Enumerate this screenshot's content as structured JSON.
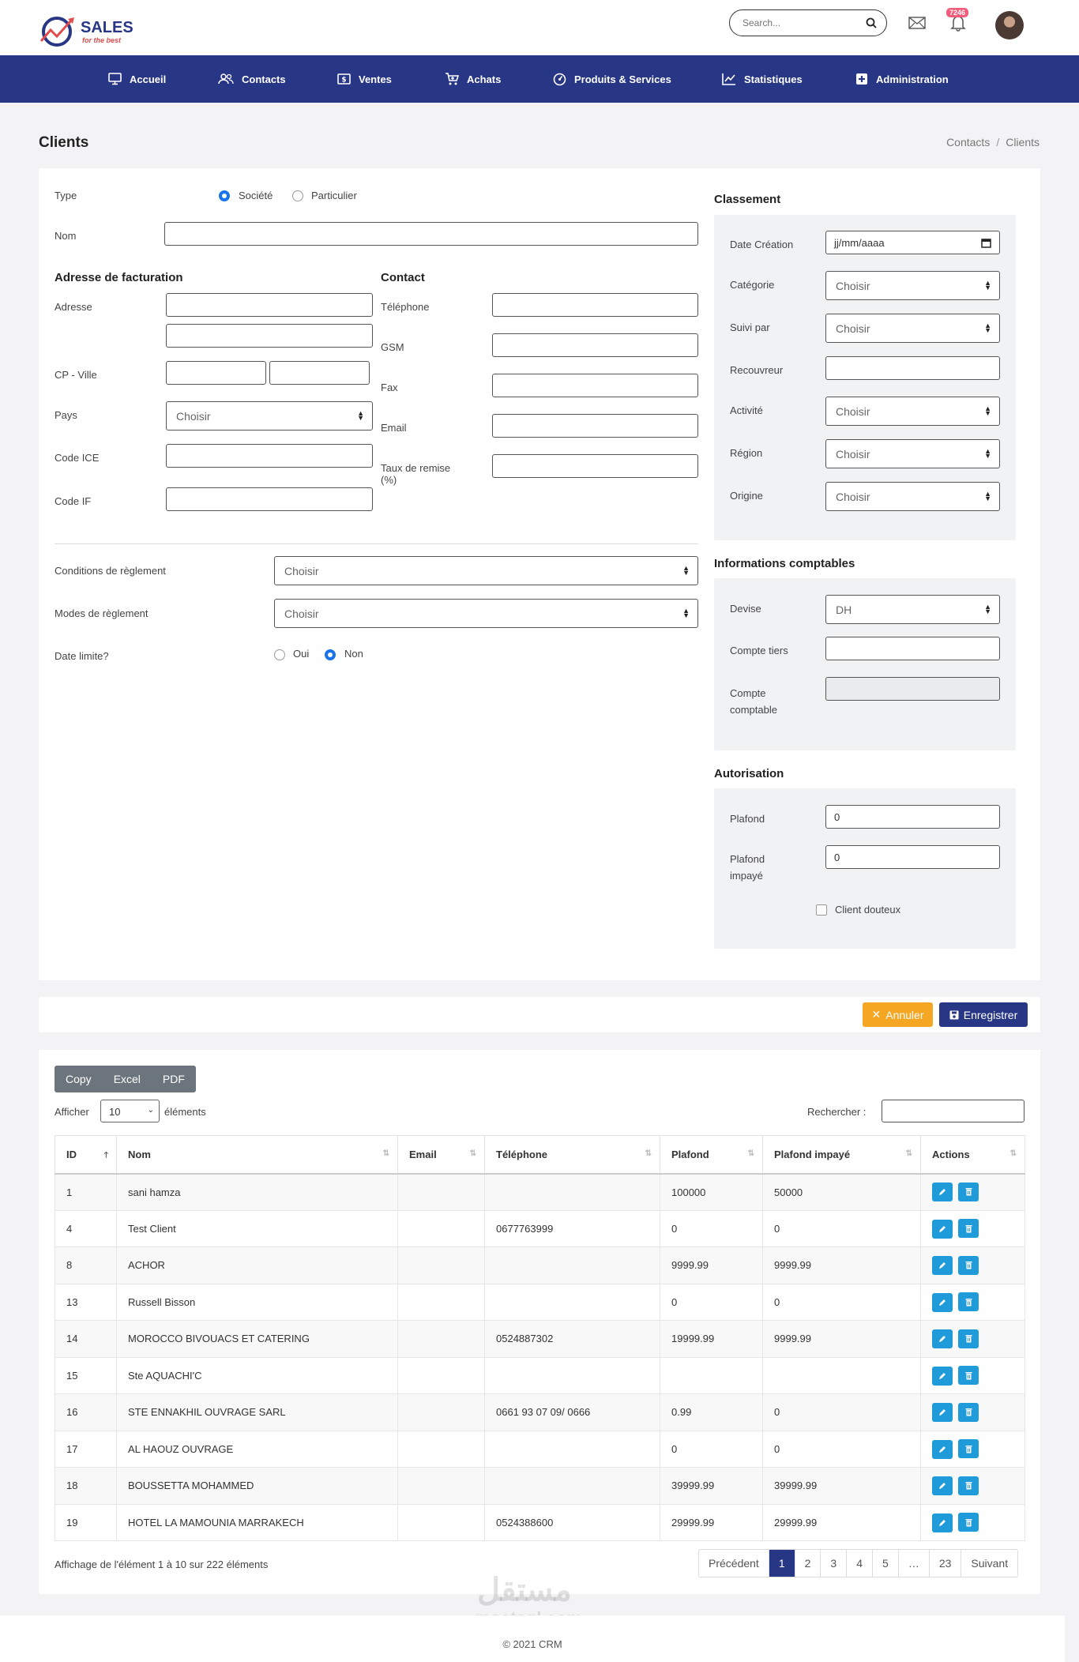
{
  "brand": {
    "name": "SALES",
    "tagline": "for the best"
  },
  "search": {
    "placeholder": "Search..."
  },
  "notifications": {
    "count": "7246"
  },
  "nav": {
    "items": [
      {
        "label": "Accueil",
        "icon": "monitor-icon"
      },
      {
        "label": "Contacts",
        "icon": "users-icon"
      },
      {
        "label": "Ventes",
        "icon": "dollar-icon"
      },
      {
        "label": "Achats",
        "icon": "cart-icon"
      },
      {
        "label": "Produits & Services",
        "icon": "dashboard-icon"
      },
      {
        "label": "Statistiques",
        "icon": "chart-icon"
      },
      {
        "label": "Administration",
        "icon": "plus-square-icon"
      }
    ]
  },
  "page": {
    "title": "Clients"
  },
  "breadcrumb": {
    "items": [
      "Contacts",
      "Clients"
    ],
    "separator": "/"
  },
  "form": {
    "type_label": "Type",
    "type_options": [
      "Société",
      "Particulier"
    ],
    "nom_label": "Nom",
    "billing": {
      "title": "Adresse de facturation",
      "address_label": "Adresse",
      "cp_ville_label": "CP - Ville",
      "pays_label": "Pays",
      "pays_value": "Choisir",
      "ice_label": "Code ICE",
      "if_label": "Code IF"
    },
    "contact": {
      "title": "Contact",
      "telephone_label": "Téléphone",
      "gsm_label": "GSM",
      "fax_label": "Fax",
      "email_label": "Email",
      "remise_label_1": "Taux de remise",
      "remise_label_2": "(%)"
    },
    "conditions_label": "Conditions de règlement",
    "conditions_value": "Choisir",
    "modes_label": "Modes de règlement",
    "modes_value": "Choisir",
    "date_limite_label": "Date limite?",
    "date_limite_options": [
      "Oui",
      "Non"
    ]
  },
  "classement": {
    "title": "Classement",
    "date_label": "Date Création",
    "date_placeholder": "jj/mm/aaaa",
    "categorie_label": "Catégorie",
    "categorie_value": "Choisir",
    "suivi_label": "Suivi par",
    "suivi_value": "Choisir",
    "recouvreur_label": "Recouvreur",
    "activite_label": "Activité",
    "activite_value": "Choisir",
    "region_label": "Région",
    "region_value": "Choisir",
    "origine_label": "Origine",
    "origine_value": "Choisir"
  },
  "comptable": {
    "title": "Informations comptables",
    "devise_label": "Devise",
    "devise_value": "DH",
    "tiers_label": "Compte tiers",
    "compte_label_1": "Compte",
    "compte_label_2": "comptable"
  },
  "autorisation": {
    "title": "Autorisation",
    "plafond_label": "Plafond",
    "plafond_value": "0",
    "impaye_label_1": "Plafond",
    "impaye_label_2": "impayé",
    "impaye_value": "0",
    "douteux_label": "Client douteux"
  },
  "actions": {
    "cancel": "Annuler",
    "save": "Enregistrer"
  },
  "table": {
    "export_buttons": [
      "Copy",
      "Excel",
      "PDF"
    ],
    "show_label": "Afficher",
    "show_value": "10",
    "show_suffix": "éléments",
    "search_label": "Rechercher :",
    "columns": [
      "ID",
      "Nom",
      "Email",
      "Téléphone",
      "Plafond",
      "Plafond impayé",
      "Actions"
    ],
    "rows": [
      [
        "1",
        "sani hamza",
        "",
        "",
        "100000",
        "50000"
      ],
      [
        "4",
        "Test Client",
        "",
        "0677763999",
        "0",
        "0"
      ],
      [
        "8",
        "ACHOR",
        "",
        "",
        "9999.99",
        "9999.99"
      ],
      [
        "13",
        "Russell Bisson",
        "",
        "",
        "0",
        "0"
      ],
      [
        "14",
        "MOROCCO BIVOUACS ET CATERING",
        "",
        "0524887302",
        "19999.99",
        "9999.99"
      ],
      [
        "15",
        "Ste AQUACHI'C",
        "",
        "",
        "",
        ""
      ],
      [
        "16",
        "STE ENNAKHIL OUVRAGE SARL",
        "",
        "0661 93 07 09/ 0666",
        "0.99",
        "0"
      ],
      [
        "17",
        "AL HAOUZ OUVRAGE",
        "",
        "",
        "0",
        "0"
      ],
      [
        "18",
        "BOUSSETTA MOHAMMED",
        "",
        "",
        "39999.99",
        "39999.99"
      ],
      [
        "19",
        "HOTEL LA MAMOUNIA MARRAKECH",
        "",
        "0524388600",
        "29999.99",
        "29999.99"
      ]
    ],
    "info": "Affichage de l'élément 1 à 10 sur 222 éléments",
    "pagination": [
      "Précédent",
      "1",
      "2",
      "3",
      "4",
      "5",
      "…",
      "23",
      "Suivant"
    ]
  },
  "watermark": {
    "text": "مستقل",
    "domain": "mostaql.com"
  },
  "footer": {
    "text": "© 2021 CRM"
  },
  "colors": {
    "primary": "#283686",
    "accent": "#1a73e8",
    "warning": "#f5a623",
    "action": "#1e9bd8",
    "badge": "#f05c7a"
  }
}
